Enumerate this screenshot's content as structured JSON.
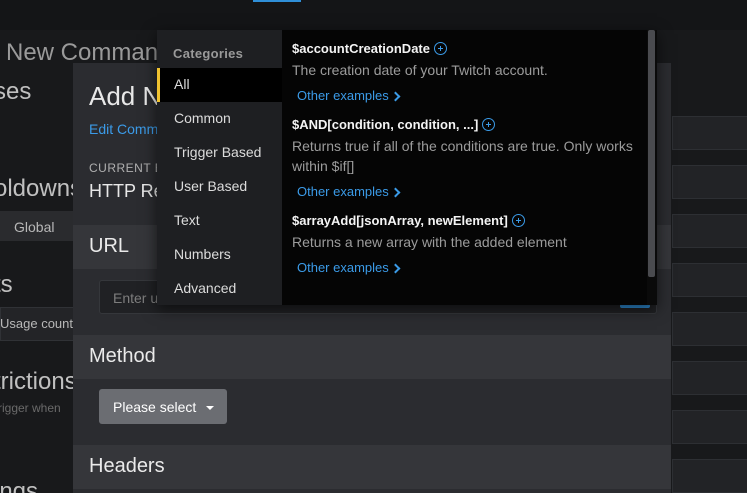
{
  "background": {
    "title": "New Command",
    "headings": [
      "ses",
      "oldowns",
      "ts",
      "trictions",
      "ings"
    ],
    "global_tab": "Global",
    "usage_count": "Usage count",
    "trigger_when": "rigger when"
  },
  "modal": {
    "title": "Add N",
    "edit_link": "Edit Comm",
    "current_label": "CURRENT E",
    "current_value": "HTTP Re",
    "sections": {
      "url": "URL",
      "method": "Method",
      "headers": "Headers"
    },
    "url_placeholder": "Enter u",
    "method_select": "Please select"
  },
  "variables_popup": {
    "categories_title": "Categories",
    "categories": [
      "All",
      "Common",
      "Trigger Based",
      "User Based",
      "Text",
      "Numbers",
      "Advanced"
    ],
    "active_category": "All",
    "variables": [
      {
        "name": "$accountCreationDate",
        "description": "The creation date of your Twitch account.",
        "link": "Other examples"
      },
      {
        "name": "$AND[condition, condition, ...]",
        "description": "Returns true if all of the conditions are true. Only works within $if[]",
        "link": "Other examples"
      },
      {
        "name": "$arrayAdd[jsonArray, newElement]",
        "description": "Returns a new array with the added element",
        "link": "Other examples"
      }
    ]
  },
  "colors": {
    "accent_blue": "#3b9be8",
    "active_category_marker": "#f0c230",
    "popup_bg": "#050505"
  }
}
